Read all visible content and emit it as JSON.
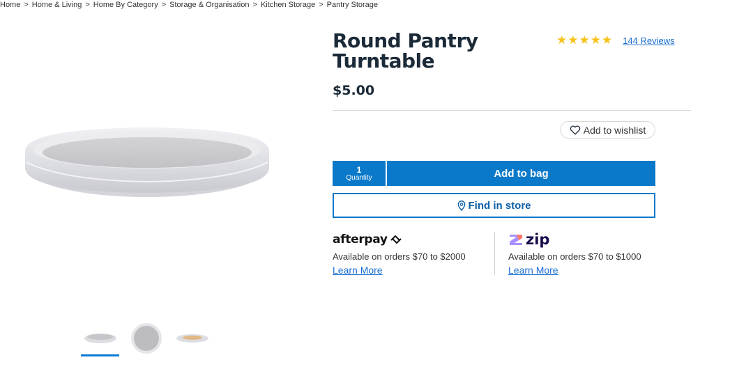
{
  "breadcrumb": {
    "items": [
      "Home",
      "Home & Living",
      "Home By Category",
      "Storage & Organisation",
      "Kitchen Storage",
      "Pantry Storage"
    ],
    "separator": ">"
  },
  "product": {
    "title": "Round Pantry Turntable",
    "price": "$5.00",
    "rating_stars": "★★★★★",
    "reviews_label": "144 Reviews"
  },
  "actions": {
    "wishlist_label": "Add to wishlist",
    "quantity_value": "1",
    "quantity_label": "Quantity",
    "add_to_bag_label": "Add to bag",
    "find_in_store_label": "Find in store"
  },
  "payments": {
    "afterpay": {
      "logo_text": "afterpay",
      "note": "Available on orders $70 to $2000",
      "link": "Learn More"
    },
    "zip": {
      "logo_text": "zip",
      "note": "Available on orders $70 to $1000",
      "link": "Learn More"
    }
  },
  "colors": {
    "accent": "#0b79c9",
    "star": "#f7c21b",
    "link": "#1a6dd0"
  }
}
